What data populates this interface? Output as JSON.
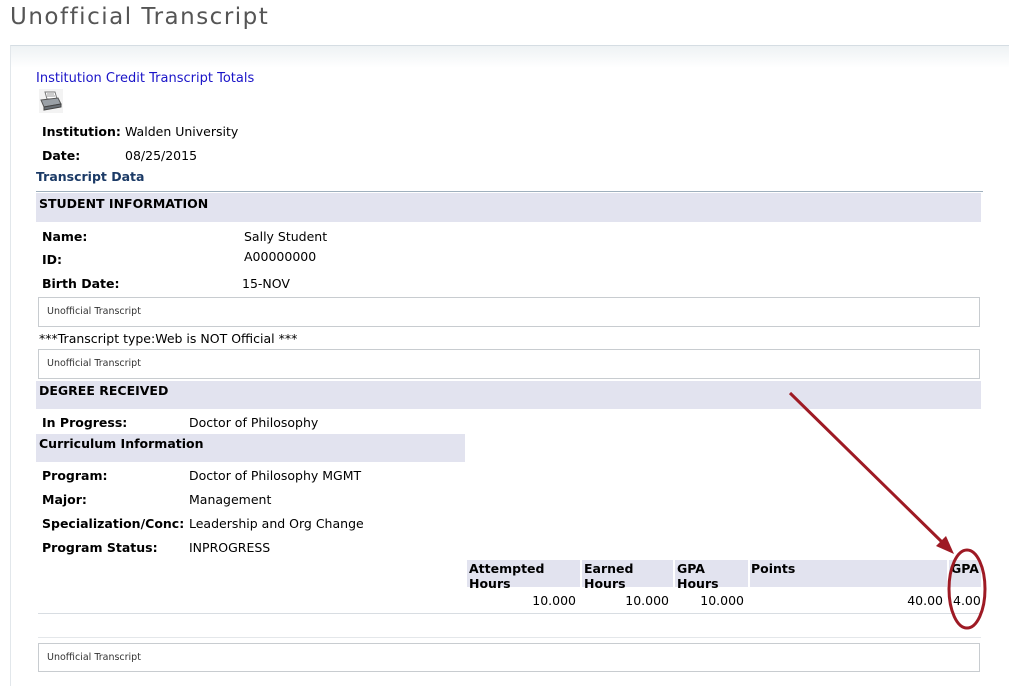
{
  "page_title": "Unofficial Transcript",
  "link_text": "Institution Credit Transcript Totals",
  "icon_name": "print-icon",
  "institution": {
    "label": "Institution:",
    "value": "Walden University"
  },
  "date": {
    "label": "Date:",
    "value": "08/25/2015"
  },
  "transcript_data_heading": "Transcript Data",
  "student_information": {
    "heading": "STUDENT INFORMATION",
    "name": {
      "label": "Name:",
      "value": "Sally Student"
    },
    "id": {
      "label": "ID:",
      "value": "A00000000"
    },
    "birth_date": {
      "label": "Birth Date:",
      "value": "15-NOV"
    }
  },
  "unofficial_box_text": "Unofficial Transcript",
  "transcript_type_note": "***Transcript type:Web is NOT Official ***",
  "degree_received": {
    "heading": "DEGREE RECEIVED",
    "in_progress": {
      "label": "In Progress:",
      "value": "Doctor of Philosophy"
    }
  },
  "curriculum": {
    "heading": "Curriculum Information",
    "program": {
      "label": "Program:",
      "value": "Doctor of Philosophy MGMT"
    },
    "major": {
      "label": "Major:",
      "value": "Management"
    },
    "specialization": {
      "label": "Specialization/Conc:",
      "value": "Leadership and Org Change"
    },
    "status": {
      "label": "Program Status:",
      "value": "INPROGRESS"
    }
  },
  "totals": {
    "headers": {
      "attempted": "Attempted Hours",
      "earned": "Earned Hours",
      "gpa_hours": "GPA Hours",
      "points": "Points",
      "gpa": "GPA"
    },
    "values": {
      "attempted": "10.000",
      "earned": "10.000",
      "gpa_hours": "10.000",
      "points": "40.00",
      "gpa": "4.00"
    }
  },
  "annotation_color": "#9e1a24"
}
